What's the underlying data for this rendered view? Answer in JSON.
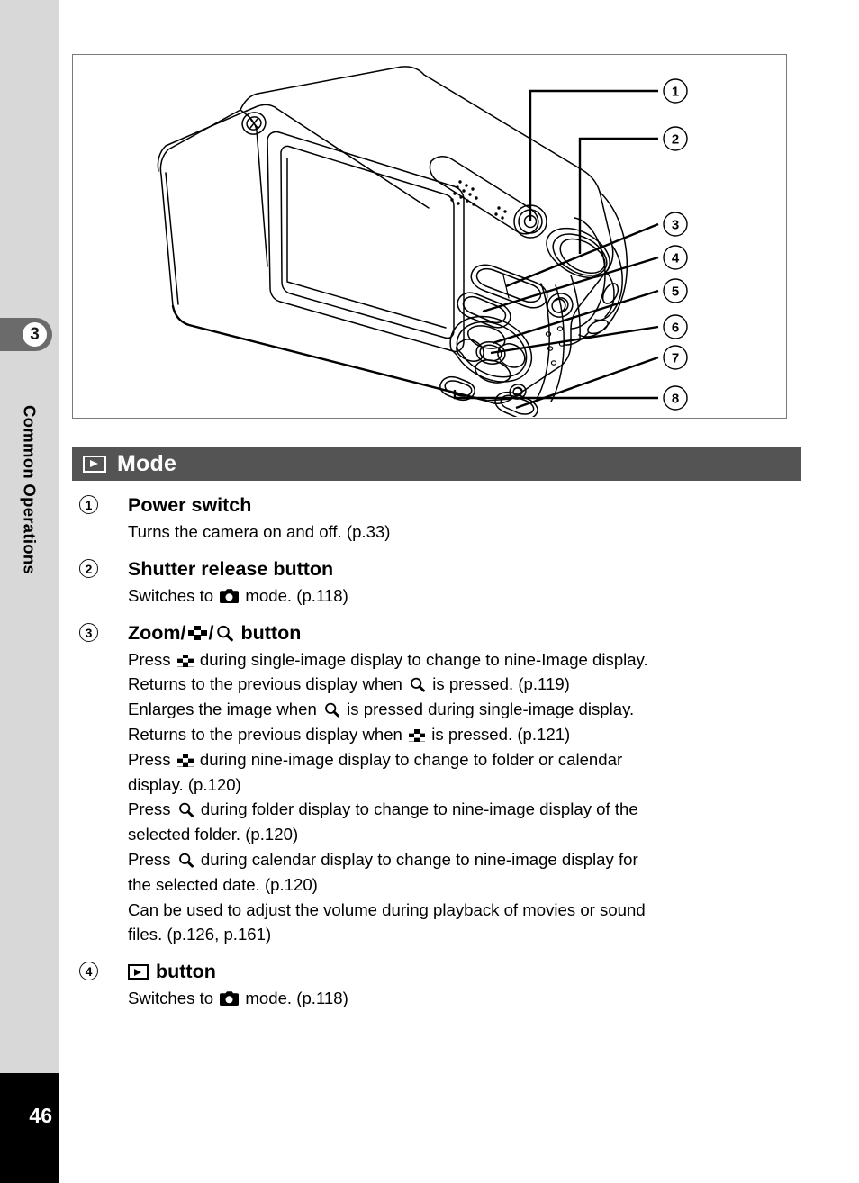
{
  "sidebar": {
    "chapter_number": "3",
    "chapter_name": "Common Operations",
    "page_number": "46"
  },
  "figure": {
    "caption": "",
    "callouts": [
      "1",
      "2",
      "3",
      "4",
      "5",
      "6",
      "7",
      "8"
    ],
    "subject": "camera-rear-illustration"
  },
  "section": {
    "icon": "playback-mode-icon",
    "title": "Mode"
  },
  "items": [
    {
      "number": "1",
      "title": "Power switch",
      "lines": [
        "Turns the camera on and off. (p.33)"
      ]
    },
    {
      "number": "2",
      "title": "Shutter release button",
      "lines": [
        "Switches to",
        "mode. (p.118)"
      ]
    },
    {
      "number": "3",
      "title_parts": [
        "Zoom/",
        "/",
        " button"
      ],
      "title_icons": [
        "nine-image-icon",
        "magnify-icon"
      ],
      "paragraphs": [
        "Press",
        "during single-image display to change to nine-Image display.",
        "Returns to the previous display when",
        "is pressed. (p.119)",
        "Enlarges the image when",
        "is pressed during single-image display.",
        "Returns to the previous display when",
        "is pressed. (p.121)",
        "Press",
        "during nine-image display to change to folder or calendar",
        "display. (p.120)",
        "Press",
        "during folder display to change to nine-image display of the",
        "selected folder. (p.120)",
        "Press",
        "during calendar display to change to nine-image display for",
        "the selected date. (p.120)",
        "Can be used to adjust the volume during playback of movies or sound",
        "files. (p.126, p.161)"
      ]
    },
    {
      "number": "4",
      "title_suffix": "button",
      "title_icon": "playback-mode-icon",
      "lines": [
        "Switches to",
        "mode. (p.118)"
      ]
    }
  ],
  "text": {
    "item1_desc": "Turns the camera on and off. (p.33)",
    "switches_to": "Switches to",
    "mode_p118": "mode. (p.118)",
    "zoom_label": "Zoom/",
    "slash": "/",
    "button_label": "button",
    "l1a": "Press",
    "l1b": "during single-image display to change to nine-Image display.",
    "l2a": "Returns to the previous display when",
    "l2b": "is pressed. (p.119)",
    "l3a": "Enlarges the image when",
    "l3b": "is pressed during single-image display.",
    "l4a": "Returns to the previous display when",
    "l4b": "is pressed. (p.121)",
    "l5a": "Press",
    "l5b": "during nine-image display to change to folder or calendar",
    "l6": "display. (p.120)",
    "l7a": "Press",
    "l7b": "during folder display to change to nine-image display of the",
    "l8": "selected folder. (p.120)",
    "l9a": "Press",
    "l9b": "during calendar display to change to nine-image display for",
    "l10": "the selected date. (p.120)",
    "l11": "Can be used to adjust the volume during playback of movies or sound",
    "l12": "files. (p.126, p.161)"
  },
  "colors": {
    "sidebar_bg": "#d8d8d8",
    "chapter_tab_bg": "#6b6b6b",
    "section_bar_bg": "#545454",
    "page_block_bg": "#000000",
    "figure_border": "#7a7a7a"
  }
}
